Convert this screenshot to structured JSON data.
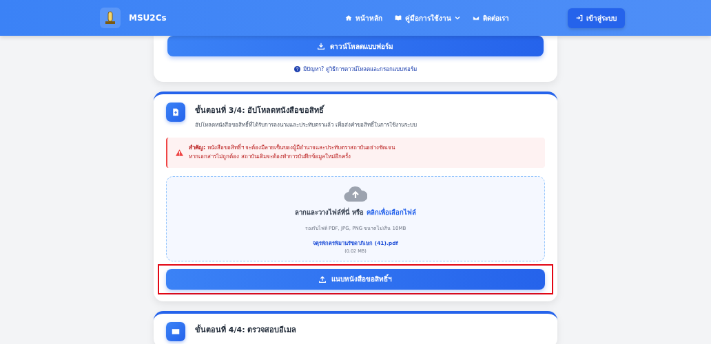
{
  "navbar": {
    "brand": "MSU2Cs",
    "links": [
      {
        "label": "หน้าหลัก",
        "dropdown": false
      },
      {
        "label": "คู่มือการใช้งาน",
        "dropdown": true
      },
      {
        "label": "ติดต่อเรา",
        "dropdown": false
      }
    ],
    "login_button": "เข้าสู่ระบบ"
  },
  "download_card": {
    "button": "ดาวน์โหลดแบบฟอร์ม",
    "help_link": "มีปัญหา? ดูวิธีการดาวน์โหลดและกรอกแบบฟอร์ม"
  },
  "upload_card": {
    "title": "ขั้นตอนที่ 3/4: อัปโหลดหนังสือขอสิทธิ์",
    "subtitle": "อัปโหลดหนังสือขอสิทธิ์ที่ได้รับการลงนามและประทับตราแล้ว เพื่อส่งคำขอสิทธิ์ในการใช้งานระบบ",
    "warning_lines": [
      "**สำคัญ:** หนังสือขอสิทธิ์ฯ จะต้องมีลายเซ็นของผู้มีอำนาจและประทับตราสถาบันอย่างชัดเจน",
      "หากเอกสารไม่ถูกต้อง สถาบันเดิมจะต้องทำการบันทึกข้อมูลใหม่อีกครั้ง"
    ],
    "dropzone": {
      "prompt": "ลากและวางไฟล์ที่นี่ หรือ",
      "browse_link": "คลิกเพื่อเลือกไฟล์",
      "hint": "รองรับไฟล์ PDF, JPG, PNG ขนาดไม่เกิน 10MB",
      "file_name": "จตุรพักตรพิมานรัชดาภิเษก (41).pdf",
      "file_size": "(0.02 MB)"
    },
    "submit_button": {
      "label": "แนบหนังสือขอสิทธิ์ฯ",
      "highlighted": true
    }
  },
  "email_card": {
    "title": "ขั้นตอนที่ 4/4: ตรวจสอบอีเมล"
  }
}
